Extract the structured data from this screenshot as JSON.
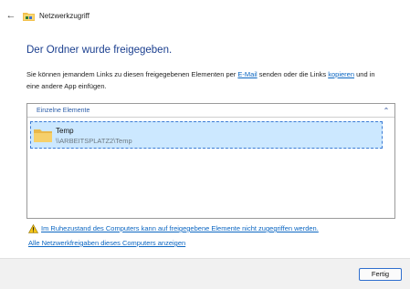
{
  "window": {
    "title": "Netzwerkzugriff"
  },
  "main": {
    "heading": "Der Ordner wurde freigegeben.",
    "desc_part1": "Sie können jemandem Links zu diesen freigegebenen Elementen per ",
    "email_link": "E-Mail",
    "desc_part2": " senden oder die Links ",
    "copy_link": "kopieren",
    "desc_part3": " und in eine andere App einfügen."
  },
  "panel": {
    "header": "Einzelne Elemente",
    "items": [
      {
        "name": "Temp",
        "path": "\\\\ARBEITSPLATZ2\\Temp"
      }
    ]
  },
  "links": {
    "sleep_warning": "Im Ruhezustand des Computers kann auf freigegebene Elemente nicht zugegriffen werden.",
    "show_all": "Alle Netzwerkfreigaben dieses Computers anzeigen"
  },
  "footer": {
    "done_label": "Fertig"
  },
  "icons": {
    "back": "back-arrow-icon",
    "window": "network-folder-icon",
    "collapse": "chevron-up-icon",
    "folder": "folder-icon",
    "warning": "warning-icon"
  },
  "colors": {
    "heading": "#1b3f8f",
    "link": "#0b66c2",
    "selection_bg": "#cce8ff",
    "selection_border": "#3a7bd5"
  }
}
